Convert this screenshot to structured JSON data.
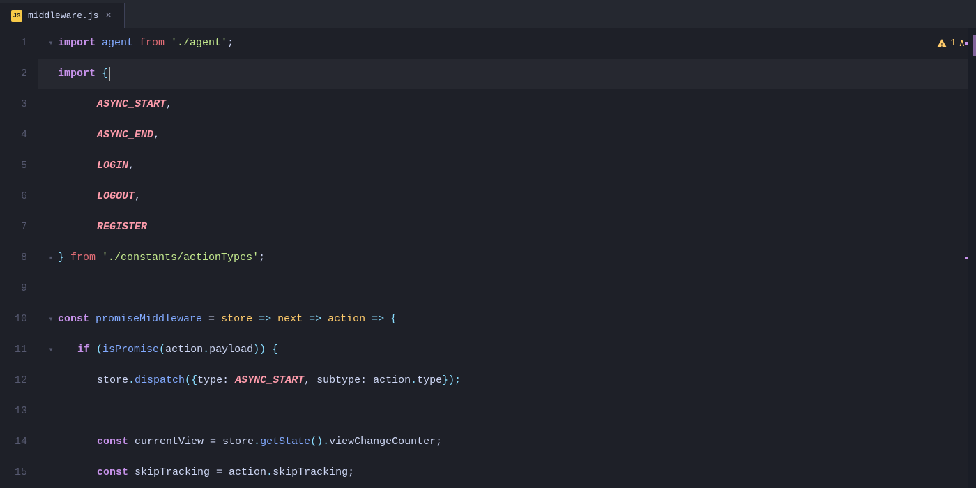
{
  "tab": {
    "icon_label": "JS",
    "filename": "middleware.js",
    "close_icon": "×"
  },
  "warning": {
    "icon": "⚠",
    "count": "1",
    "chevron": "∧"
  },
  "lines": [
    {
      "number": "1",
      "fold": "▾",
      "has_fold": true,
      "tokens": [
        {
          "type": "kw-import",
          "text": "import "
        },
        {
          "type": "func-name",
          "text": "agent "
        },
        {
          "type": "kw-from",
          "text": "from "
        },
        {
          "type": "string",
          "text": "'./agent'"
        },
        {
          "type": "plain",
          "text": ";"
        }
      ]
    },
    {
      "number": "2",
      "fold": "",
      "has_fold": false,
      "tokens": [
        {
          "type": "kw-import",
          "text": "import "
        },
        {
          "type": "punctuation",
          "text": "{"
        },
        {
          "type": "cursor",
          "text": ""
        },
        {
          "type": "plain",
          "text": ""
        }
      ],
      "cursor_after_brace": true
    },
    {
      "number": "3",
      "fold": "",
      "has_fold": false,
      "indent": 2,
      "tokens": [
        {
          "type": "constant-name",
          "text": "ASYNC_START"
        },
        {
          "type": "plain",
          "text": ","
        }
      ]
    },
    {
      "number": "4",
      "fold": "",
      "has_fold": false,
      "indent": 2,
      "tokens": [
        {
          "type": "constant-name",
          "text": "ASYNC_END"
        },
        {
          "type": "plain",
          "text": ","
        }
      ]
    },
    {
      "number": "5",
      "fold": "",
      "has_fold": false,
      "indent": 2,
      "tokens": [
        {
          "type": "constant-name",
          "text": "LOGIN"
        },
        {
          "type": "plain",
          "text": ","
        }
      ]
    },
    {
      "number": "6",
      "fold": "",
      "has_fold": false,
      "indent": 2,
      "tokens": [
        {
          "type": "constant-name",
          "text": "LOGOUT"
        },
        {
          "type": "plain",
          "text": ","
        }
      ]
    },
    {
      "number": "7",
      "fold": "",
      "has_fold": false,
      "indent": 2,
      "tokens": [
        {
          "type": "constant-name",
          "text": "REGISTER"
        }
      ]
    },
    {
      "number": "8",
      "fold": "▪",
      "has_fold": true,
      "tokens": [
        {
          "type": "punctuation",
          "text": "} "
        },
        {
          "type": "kw-from",
          "text": "from "
        },
        {
          "type": "string",
          "text": "'./constants/actionTypes'"
        },
        {
          "type": "plain",
          "text": ";"
        }
      ]
    },
    {
      "number": "9",
      "fold": "",
      "has_fold": false,
      "tokens": []
    },
    {
      "number": "10",
      "fold": "▾",
      "has_fold": true,
      "tokens": [
        {
          "type": "kw-const",
          "text": "const "
        },
        {
          "type": "func-name",
          "text": "promiseMiddleware "
        },
        {
          "type": "plain",
          "text": "= "
        },
        {
          "type": "param",
          "text": "store "
        },
        {
          "type": "arrow",
          "text": "=> "
        },
        {
          "type": "param",
          "text": "next "
        },
        {
          "type": "arrow",
          "text": "=> "
        },
        {
          "type": "param",
          "text": "action "
        },
        {
          "type": "arrow",
          "text": "=> "
        },
        {
          "type": "punctuation",
          "text": "{"
        }
      ]
    },
    {
      "number": "11",
      "fold": "▾",
      "has_fold": true,
      "indent": 1,
      "tokens": [
        {
          "type": "kw-if",
          "text": "if "
        },
        {
          "type": "punctuation",
          "text": "("
        },
        {
          "type": "func-name",
          "text": "isPromise"
        },
        {
          "type": "punctuation",
          "text": "("
        },
        {
          "type": "plain",
          "text": "action"
        },
        {
          "type": "punctuation",
          "text": "."
        },
        {
          "type": "property",
          "text": "payload"
        },
        {
          "type": "punctuation",
          "text": ")) {"
        }
      ]
    },
    {
      "number": "12",
      "fold": "",
      "has_fold": false,
      "indent": 2,
      "tokens": [
        {
          "type": "plain",
          "text": "store"
        },
        {
          "type": "punctuation",
          "text": "."
        },
        {
          "type": "method",
          "text": "dispatch"
        },
        {
          "type": "punctuation",
          "text": "({"
        },
        {
          "type": "plain",
          "text": "type: "
        },
        {
          "type": "constant-name",
          "text": "ASYNC_START"
        },
        {
          "type": "plain",
          "text": ", subtype: action"
        },
        {
          "type": "punctuation",
          "text": "."
        },
        {
          "type": "plain",
          "text": "type"
        },
        {
          "type": "punctuation",
          "text": "});"
        }
      ]
    },
    {
      "number": "13",
      "fold": "",
      "has_fold": false,
      "tokens": []
    },
    {
      "number": "14",
      "fold": "",
      "has_fold": false,
      "indent": 2,
      "tokens": [
        {
          "type": "kw-const",
          "text": "const "
        },
        {
          "type": "plain",
          "text": "currentView = store"
        },
        {
          "type": "punctuation",
          "text": "."
        },
        {
          "type": "method",
          "text": "getState"
        },
        {
          "type": "punctuation",
          "text": "()."
        },
        {
          "type": "plain",
          "text": "viewChangeCounter;"
        }
      ]
    },
    {
      "number": "15",
      "fold": "",
      "has_fold": false,
      "indent": 2,
      "tokens": [
        {
          "type": "kw-const",
          "text": "const "
        },
        {
          "type": "plain",
          "text": "skipTracking = action"
        },
        {
          "type": "punctuation",
          "text": "."
        },
        {
          "type": "plain",
          "text": "skipTracking;"
        }
      ]
    }
  ]
}
